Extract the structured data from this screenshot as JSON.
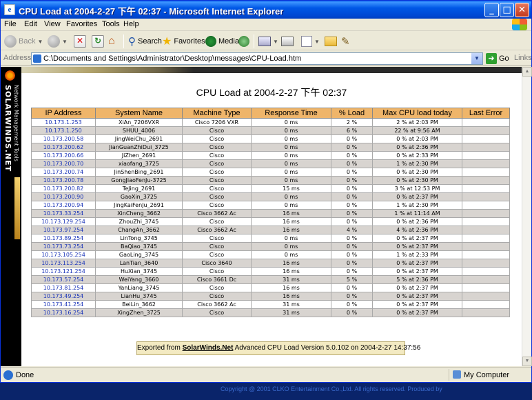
{
  "window": {
    "title": "CPU Load at 2004-2-27 下午 02:37 - Microsoft Internet Explorer",
    "minimize": "_",
    "maximize": "□",
    "close": "✕"
  },
  "menu": [
    "File",
    "Edit",
    "View",
    "Favorites",
    "Tools",
    "Help"
  ],
  "toolbar": {
    "back": "Back",
    "search": "Search",
    "favorites": "Favorites",
    "media": "Media"
  },
  "address": {
    "label": "Address",
    "url": "C:\\Documents and Settings\\Administrator\\Desktop\\messages\\CPU-Load.htm",
    "go": "Go",
    "links": "Links"
  },
  "brand": {
    "vertical": "SOLARWINDS.NET",
    "subtitle": "Network Management Tools"
  },
  "page": {
    "title": "CPU Load at 2004-2-27 下午  02:37",
    "columns": [
      "IP Address",
      "System Name",
      "Machine Type",
      "Response Time",
      "% Load",
      "Max CPU load today",
      "Last Error"
    ],
    "rows": [
      [
        "10.173.1.253",
        "XiAn_7206VXR",
        "Cisco 7206 VXR",
        "0 ms",
        "2 %",
        "2 % at 2:03 PM",
        ""
      ],
      [
        "10.173.1.250",
        "SHUU_4006",
        "Cisco",
        "0 ms",
        "6 %",
        "22 % at 9:56 AM",
        ""
      ],
      [
        "10.173.200.58",
        "JingWeiChu_2691",
        "Cisco",
        "0 ms",
        "0 %",
        "0 % at 2:03 PM",
        ""
      ],
      [
        "10.173.200.62",
        "JianGuanZhiDui_3725",
        "Cisco",
        "0 ms",
        "0 %",
        "0 % at 2:36 PM",
        ""
      ],
      [
        "10.173.200.66",
        "JiZhen_2691",
        "Cisco",
        "0 ms",
        "0 %",
        "0 % at 2:33 PM",
        ""
      ],
      [
        "10.173.200.70",
        "xiaofang_3725",
        "Cisco",
        "0 ms",
        "0 %",
        "1 % at 2:30 PM",
        ""
      ],
      [
        "10.173.200.74",
        "JinShenBing_2691",
        "Cisco",
        "0 ms",
        "0 %",
        "0 % at 2:30 PM",
        ""
      ],
      [
        "10.173.200.78",
        "GongJiaoFenJu-3725",
        "Cisco",
        "0 ms",
        "0 %",
        "0 % at 2:30 PM",
        ""
      ],
      [
        "10.173.200.82",
        "TeJing_2691",
        "Cisco",
        "15 ms",
        "0 %",
        "3 % at 12:53 PM",
        ""
      ],
      [
        "10.173.200.90",
        "GaoXin_3725",
        "Cisco",
        "0 ms",
        "0 %",
        "0 % at 2:37 PM",
        ""
      ],
      [
        "10.173.200.94",
        "JingKaiFenJu_2691",
        "Cisco",
        "0 ms",
        "0 %",
        "1 % at 2:30 PM",
        ""
      ],
      [
        "10.173.33.254",
        "XinCheng_3662",
        "Cisco 3662 Ac",
        "16 ms",
        "0 %",
        "1 % at 11:14 AM",
        ""
      ],
      [
        "10.173.129.254",
        "ZhouZhi_3745",
        "Cisco",
        "16 ms",
        "0 %",
        "0 % at 2:36 PM",
        ""
      ],
      [
        "10.173.97.254",
        "ChangAn_3662",
        "Cisco 3662 Ac",
        "16 ms",
        "4 %",
        "4 % at 2:36 PM",
        ""
      ],
      [
        "10.173.89.254",
        "LinTong_3745",
        "Cisco",
        "0 ms",
        "0 %",
        "0 % at 2:37 PM",
        ""
      ],
      [
        "10.173.73.254",
        "BaQiao_3745",
        "Cisco",
        "0 ms",
        "0 %",
        "0 % at 2:37 PM",
        ""
      ],
      [
        "10.173.105.254",
        "GaoLing_3745",
        "Cisco",
        "0 ms",
        "0 %",
        "1 % at 2:33 PM",
        ""
      ],
      [
        "10.173.113.254",
        "LanTian_3640",
        "Cisco 3640",
        "16 ms",
        "0 %",
        "0 % at 2:37 PM",
        ""
      ],
      [
        "10.173.121.254",
        "HuXian_3745",
        "Cisco",
        "16 ms",
        "0 %",
        "0 % at 2:37 PM",
        ""
      ],
      [
        "10.173.57.254",
        "WeiYang_3660",
        "Cisco 3661 Dc",
        "31 ms",
        "5 %",
        "5 % at 2:36 PM",
        ""
      ],
      [
        "10.173.81.254",
        "YanLiang_3745",
        "Cisco",
        "16 ms",
        "0 %",
        "0 % at 2:37 PM",
        ""
      ],
      [
        "10.173.49.254",
        "LianHu_3745",
        "Cisco",
        "16 ms",
        "0 %",
        "0 % at 2:37 PM",
        ""
      ],
      [
        "10.173.41.254",
        "BeiLin_3662",
        "Cisco 3662 Ac",
        "31 ms",
        "0 %",
        "0 % at 2:37 PM",
        ""
      ],
      [
        "10.173.16.254",
        "XingZhen_3725",
        "Cisco",
        "31 ms",
        "0 %",
        "0 % at 2:37 PM",
        ""
      ]
    ],
    "footer": {
      "prefix": "Exported from ",
      "link": "SolarWinds.Net",
      "suffix": " Advanced CPU Load Version 5.0.102 on 2004-2-27 14:37:56"
    }
  },
  "status": {
    "text": "Done",
    "zone": "My Computer"
  },
  "desktop": {
    "copyright": "Copyright @ 2001 CLKO Entertainment Co.,Ltd. All rights reserved. Produced by"
  },
  "colors": {
    "header_bg": "#efb56a",
    "row_alt": "#d8d4d0",
    "ip_link": "#1a34b8",
    "title_bar": "#0058e6"
  }
}
